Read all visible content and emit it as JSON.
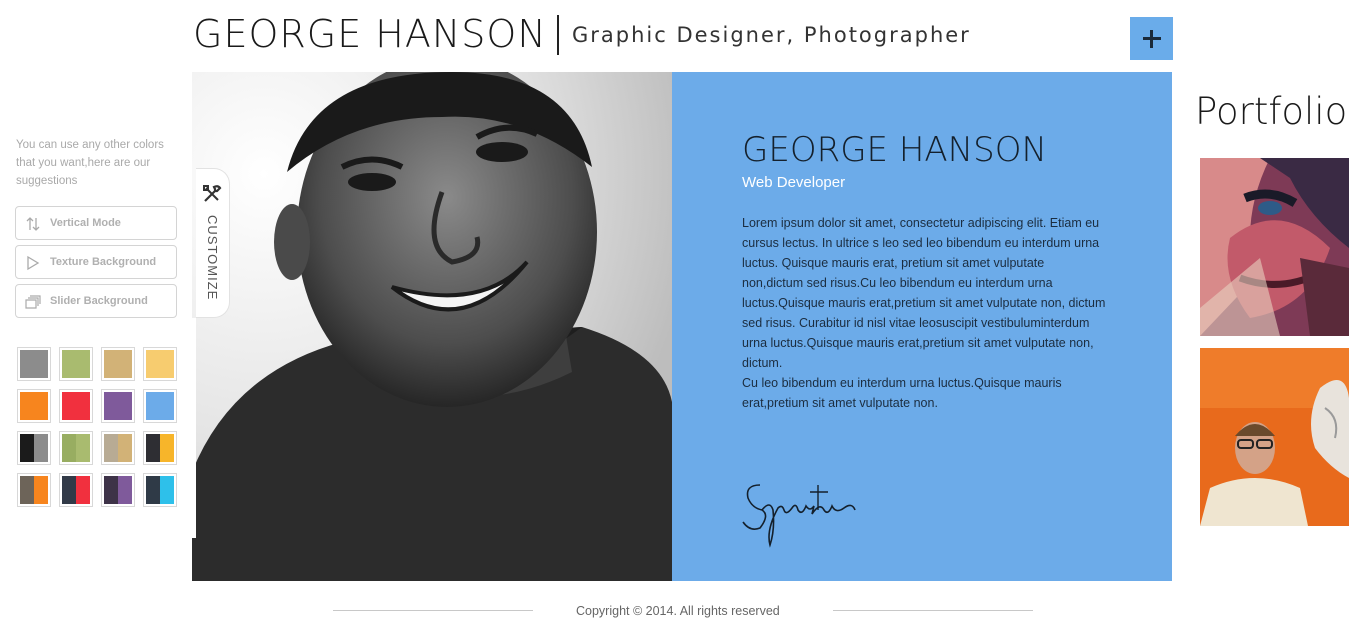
{
  "header": {
    "name": "GEORGE HANSON",
    "tagline": "Graphic Designer, Photographer",
    "plus_icon": "plus-icon",
    "accent_color": "#6aacea"
  },
  "profile": {
    "name": "GEORGE HANSON",
    "role": "Web Developer",
    "bio_1": "Lorem ipsum dolor sit amet, consectetur adipiscing elit. Etiam eu cursus lectus. In ultrice s leo sed leo bibendum eu interdum urna luctus. Quisque mauris erat, pretium sit amet vulputate non,dictum sed risus.Cu leo bibendum eu interdum urna luctus.Quisque mauris erat,pretium sit amet vulputate non, dictum sed risus. Curabitur id nisl vitae leosuscipit vestibuluminterdum urna luctus.Quisque mauris erat,pretium sit amet vulputate non, dictum.",
    "bio_2": "Cu leo bibendum eu interdum urna luctus.Quisque mauris erat,pretium sit amet vulputate non.",
    "signature": "Signature",
    "panel_color": "#6cabe9"
  },
  "customize": {
    "tab_label": "CUSTOMIZE",
    "tab_icon": "tools-icon",
    "suggestion_text": "You can use any other colors that you want,here are our suggestions",
    "buttons": [
      {
        "label": "Vertical Mode",
        "icon": "vertical-arrows-icon"
      },
      {
        "label": "Texture Background",
        "icon": "play-triangle-icon"
      },
      {
        "label": "Slider Background",
        "icon": "stacked-windows-icon"
      }
    ],
    "swatches": [
      [
        "#8c8c8c",
        "#8c8c8c"
      ],
      [
        "#a9bb6f",
        "#a9bb6f"
      ],
      [
        "#d2b277",
        "#d2b277"
      ],
      [
        "#f7cc6f",
        "#f7cc6f"
      ],
      [
        "#f7851e",
        "#f7851e"
      ],
      [
        "#f1303e",
        "#f1303e"
      ],
      [
        "#7f5a9b",
        "#7f5a9b"
      ],
      [
        "#6cabe9",
        "#6cabe9"
      ],
      [
        "#1b1b1b",
        "#8c8c8c"
      ],
      [
        "#98ad61",
        "#a9bb6f"
      ],
      [
        "#b8ab94",
        "#d2b277"
      ],
      [
        "#2e2e33",
        "#f7b52a"
      ],
      [
        "#6d6459",
        "#f7851e"
      ],
      [
        "#323a48",
        "#f1303e"
      ],
      [
        "#3e3348",
        "#7f5a9b"
      ],
      [
        "#2f3a47",
        "#2ec0ea"
      ]
    ]
  },
  "portfolio": {
    "title": "Portfolio"
  },
  "footer": {
    "copyright": "Copyright © 2014. All rights reserved"
  }
}
